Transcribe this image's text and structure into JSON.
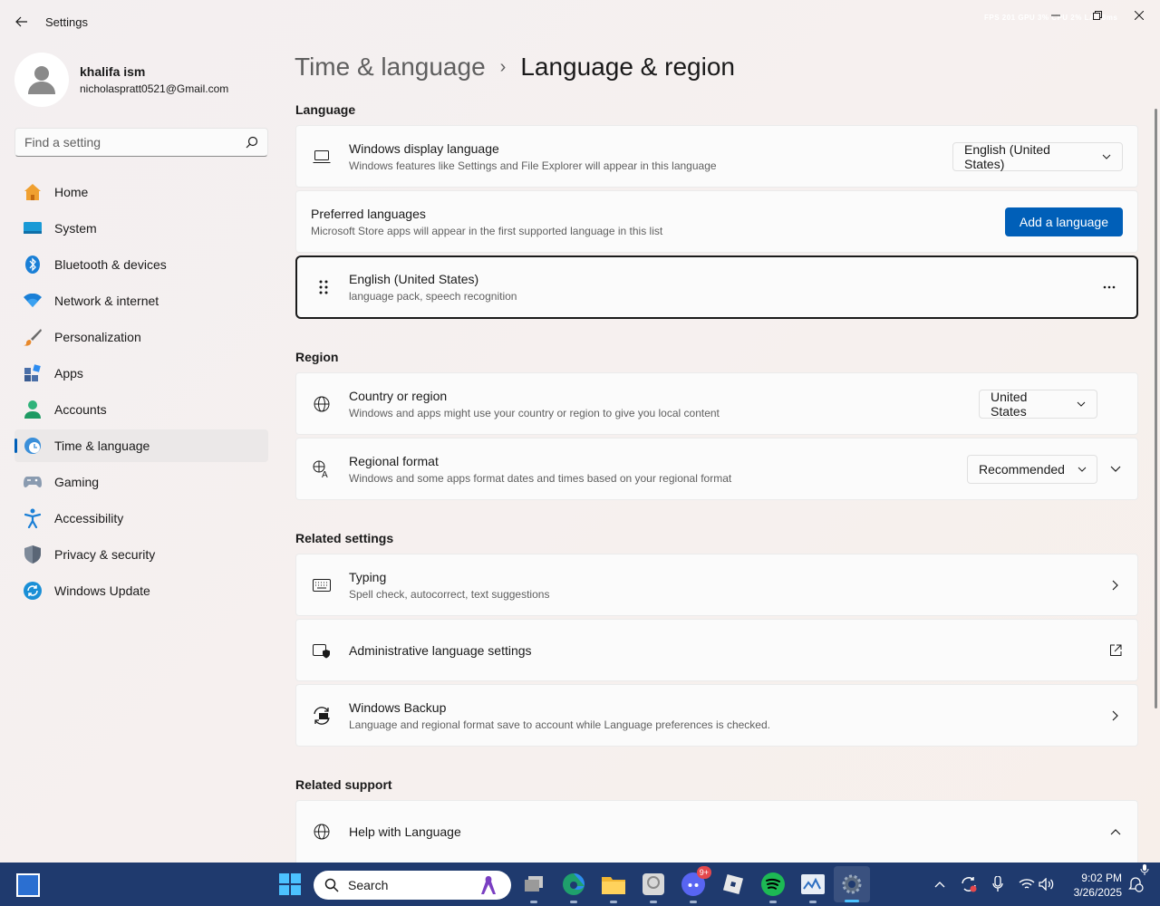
{
  "window": {
    "app_title": "Settings",
    "overlay_text": "FPS 201  GPU 3%  CPU 2%  LAT 8ms"
  },
  "profile": {
    "name": "khalifa ism",
    "email": "nicholaspratt0521@Gmail.com"
  },
  "search": {
    "placeholder": "Find a setting"
  },
  "sidebar": {
    "items": [
      {
        "label": "Home",
        "icon": "home-icon"
      },
      {
        "label": "System",
        "icon": "system-icon"
      },
      {
        "label": "Bluetooth & devices",
        "icon": "bluetooth-icon"
      },
      {
        "label": "Network & internet",
        "icon": "wifi-icon"
      },
      {
        "label": "Personalization",
        "icon": "brush-icon"
      },
      {
        "label": "Apps",
        "icon": "apps-icon"
      },
      {
        "label": "Accounts",
        "icon": "accounts-icon"
      },
      {
        "label": "Time & language",
        "icon": "clock-globe-icon",
        "active": true
      },
      {
        "label": "Gaming",
        "icon": "gamepad-icon"
      },
      {
        "label": "Accessibility",
        "icon": "accessibility-icon"
      },
      {
        "label": "Privacy & security",
        "icon": "shield-icon"
      },
      {
        "label": "Windows Update",
        "icon": "update-icon"
      }
    ]
  },
  "breadcrumb": {
    "parent": "Time & language",
    "separator": "›",
    "current": "Language & region"
  },
  "language": {
    "section_title": "Language",
    "display_language": {
      "title": "Windows display language",
      "subtitle": "Windows features like Settings and File Explorer will appear in this language",
      "value": "English (United States)"
    },
    "preferred": {
      "title": "Preferred languages",
      "subtitle": "Microsoft Store apps will appear in the first supported language in this list",
      "button": "Add a language"
    },
    "installed": {
      "title": "English (United States)",
      "subtitle": "language pack, speech recognition",
      "more": "..."
    }
  },
  "region": {
    "section_title": "Region",
    "country": {
      "title": "Country or region",
      "subtitle": "Windows and apps might use your country or region to give you local content",
      "value": "United States"
    },
    "format": {
      "title": "Regional format",
      "subtitle": "Windows and some apps format dates and times based on your regional format",
      "value": "Recommended"
    }
  },
  "related_settings": {
    "section_title": "Related settings",
    "typing": {
      "title": "Typing",
      "subtitle": "Spell check, autocorrect, text suggestions"
    },
    "admin": {
      "title": "Administrative language settings"
    },
    "backup": {
      "title": "Windows Backup",
      "subtitle": "Language and regional format save to account while Language preferences is checked."
    }
  },
  "related_support": {
    "section_title": "Related support",
    "help": {
      "title": "Help with Language"
    }
  },
  "taskbar": {
    "search_label": "Search",
    "discord_badge": "9+",
    "time": "9:02 PM",
    "date": "3/26/2025"
  },
  "colors": {
    "accent": "#005fb8",
    "taskbar": "#1f3a6e"
  }
}
